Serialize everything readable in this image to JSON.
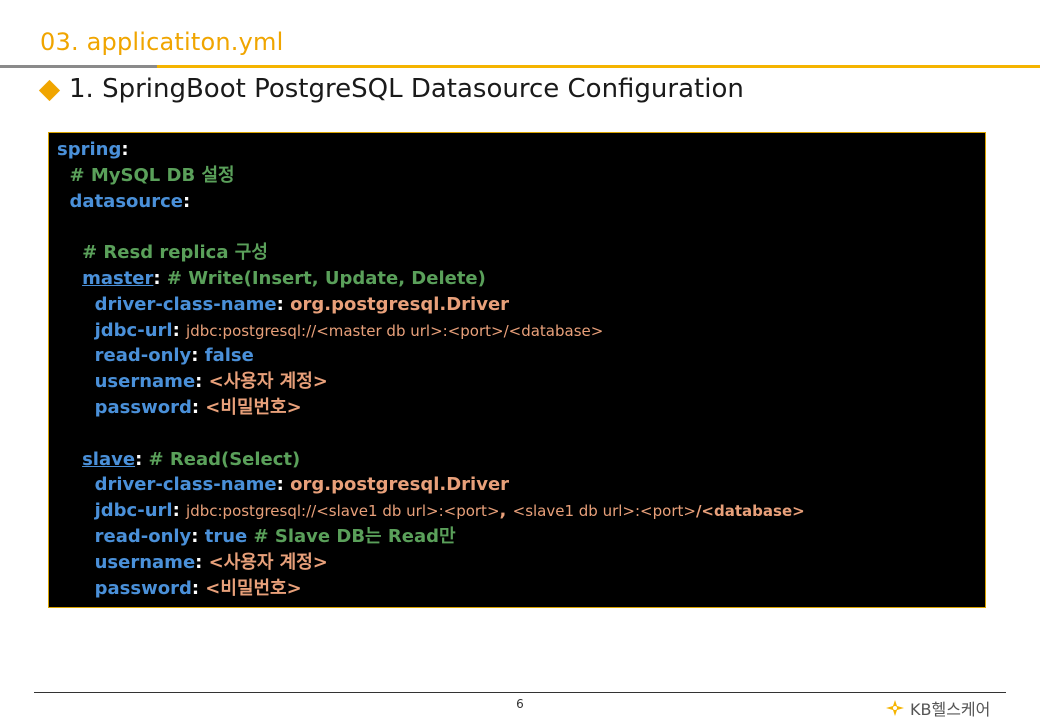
{
  "header": {
    "section_title": "03. applicatiton.yml",
    "subtitle": "1. SpringBoot PostgreSQL Datasource Configuration"
  },
  "code": {
    "l1_key": "spring",
    "l2_comment": "# MySQL DB 설정",
    "l3_key": "datasource",
    "l5_comment": "# Resd replica 구성",
    "l6_key": "master",
    "l6_comment": "# Write(Insert, Update, Delete)",
    "l7_key": "driver-class-name",
    "l7_val": "org.postgresql.Driver",
    "l8_key": "jdbc-url",
    "l8_val": "jdbc:postgresql://<master db url>:<port>/<database>",
    "l9_key": "read-only",
    "l9_val": "false",
    "l10_key": "username",
    "l10_val": "<사용자 계정>",
    "l11_key": "password",
    "l11_val": "<비밀번호>",
    "l13_key": "slave",
    "l13_comment": "# Read(Select)",
    "l14_key": "driver-class-name",
    "l14_val": "org.postgresql.Driver",
    "l15_key": "jdbc-url",
    "l15_val_a": "jdbc:postgresql://<slave1 db url>:<port>",
    "l15_sep": ", ",
    "l15_val_b": "<slave1 db url>:<port>",
    "l15_val_c": "/<database>",
    "l16_key": "read-only",
    "l16_val": "true",
    "l16_comment": "# Slave DB는 Read만",
    "l17_key": "username",
    "l17_val": "<사용자 계정>",
    "l18_key": "password",
    "l18_val": "<비밀번호>"
  },
  "footer": {
    "page_number": "6",
    "brand": "KB헬스케어"
  },
  "colors": {
    "accent": "#f0a500",
    "key": "#4a90d9",
    "comment": "#5aa05a",
    "value": "#e8a07a"
  }
}
